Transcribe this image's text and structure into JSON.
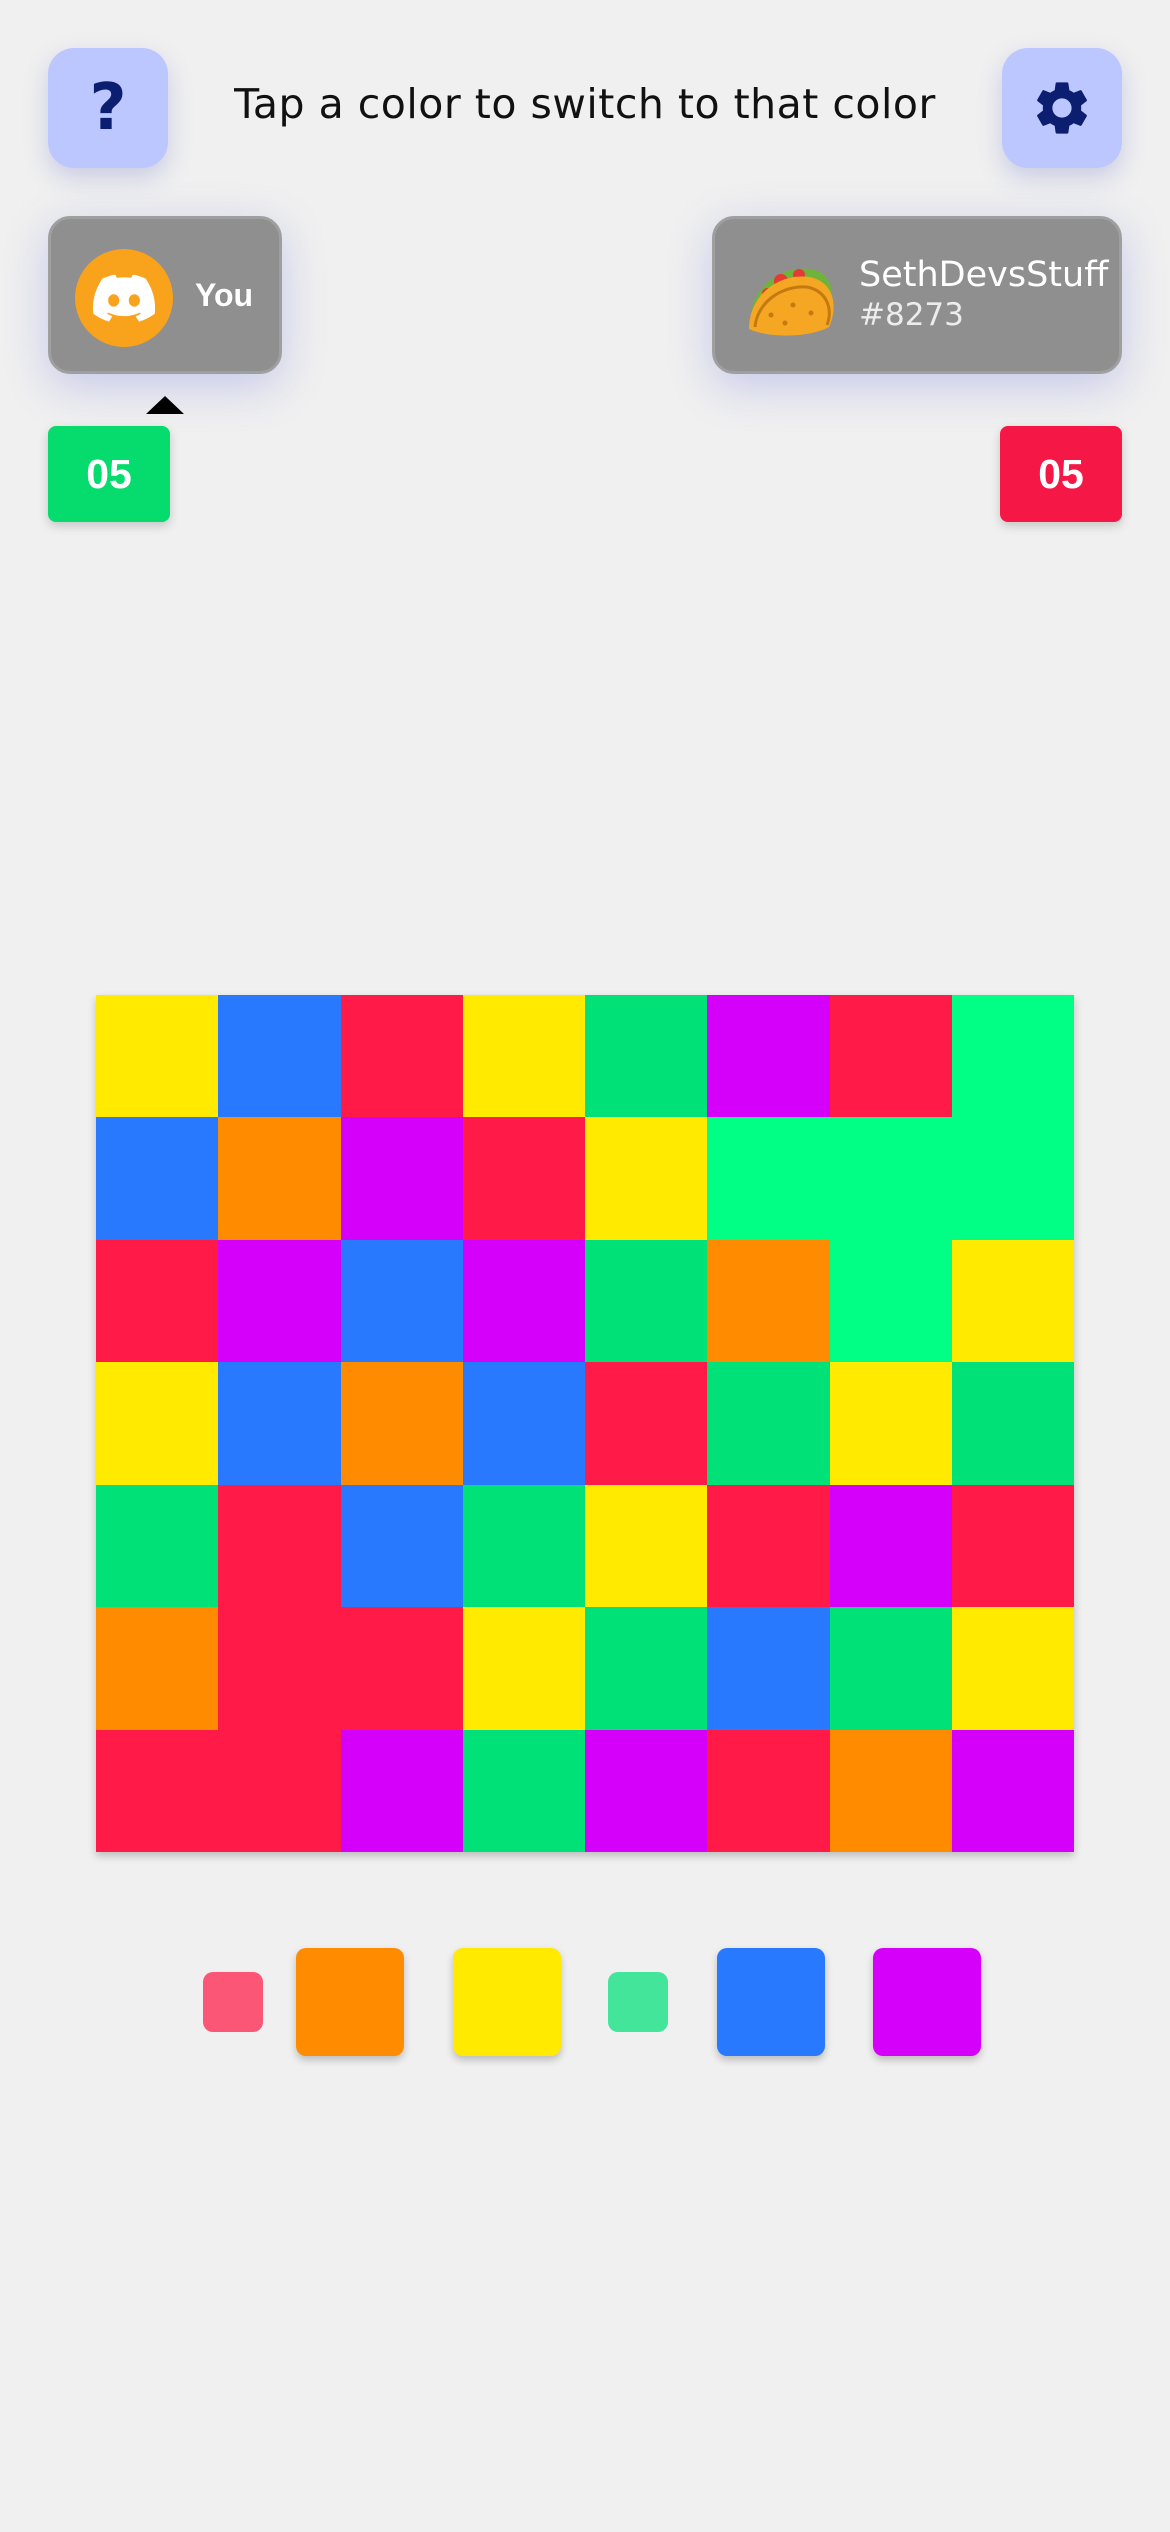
{
  "header": {
    "help_label": "?",
    "instruction": "Tap a color to switch to that color",
    "settings_icon": "gear-icon"
  },
  "players": {
    "you": {
      "label": "You",
      "avatar_icon": "discord-icon",
      "avatar_color": "#f9a21b",
      "score": "05",
      "score_color": "#06dc6e",
      "active_turn": true
    },
    "opponent": {
      "name": "SethDevsStuff",
      "tag": "#8273",
      "avatar_icon": "taco-icon",
      "score": "05",
      "score_color": "#f51847"
    }
  },
  "colors": {
    "R": "#ff1a47",
    "O": "#ff8c00",
    "Y": "#ffea00",
    "G": "#00e178",
    "B": "#2979ff",
    "P": "#d500f9",
    "M": "#00ff84"
  },
  "board": {
    "rows": 7,
    "cols": 8,
    "cells": [
      [
        "Y",
        "B",
        "R",
        "Y",
        "G",
        "P",
        "R",
        "M"
      ],
      [
        "B",
        "O",
        "P",
        "R",
        "Y",
        "M",
        "M",
        "M"
      ],
      [
        "R",
        "P",
        "B",
        "P",
        "G",
        "O",
        "M",
        "Y"
      ],
      [
        "Y",
        "B",
        "O",
        "B",
        "R",
        "G",
        "Y",
        "G"
      ],
      [
        "G",
        "R",
        "B",
        "G",
        "Y",
        "R",
        "P",
        "R"
      ],
      [
        "O",
        "R",
        "R",
        "Y",
        "G",
        "B",
        "G",
        "Y"
      ],
      [
        "R",
        "R",
        "P",
        "G",
        "P",
        "R",
        "O",
        "P"
      ]
    ]
  },
  "palette": [
    {
      "color": "R",
      "state": "disabled"
    },
    {
      "color": "O",
      "state": "available"
    },
    {
      "color": "Y",
      "state": "available"
    },
    {
      "color": "G",
      "state": "disabled"
    },
    {
      "color": "B",
      "state": "available"
    },
    {
      "color": "P",
      "state": "available"
    }
  ]
}
